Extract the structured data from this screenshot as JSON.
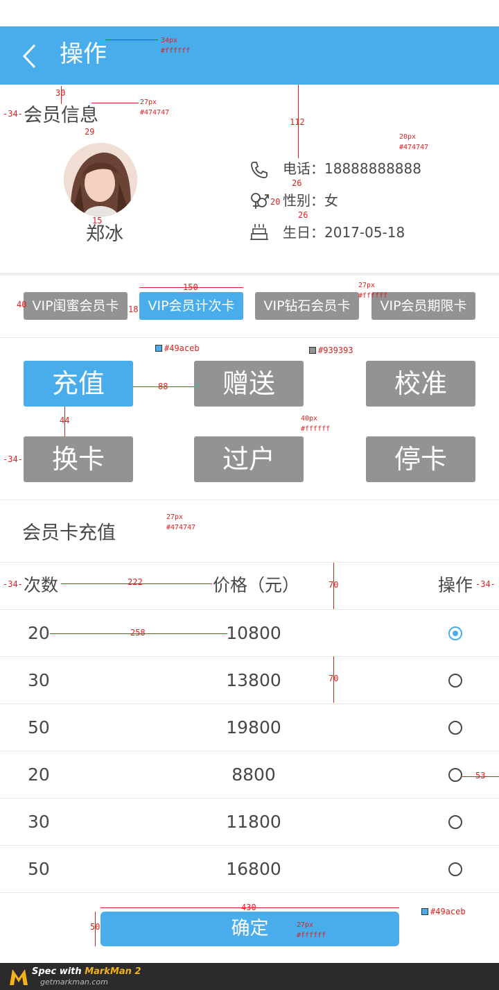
{
  "header": {
    "title": "操作",
    "bg_color": "#49aceb"
  },
  "member_info": {
    "section_title": "会员信息",
    "name": "郑冰",
    "phone": "电话：18888888888",
    "gender": "性别：女",
    "birthday": "生日：2017-05-18"
  },
  "card_tabs": [
    {
      "label": "VIP闺蜜会员卡",
      "active": false
    },
    {
      "label": "VIP会员计次卡",
      "active": true
    },
    {
      "label": "VIP钻石会员卡",
      "active": false
    },
    {
      "label": "VIP会员期限卡",
      "active": false
    }
  ],
  "operations": [
    {
      "label": "充值",
      "active": true
    },
    {
      "label": "赠送",
      "active": false
    },
    {
      "label": "校准",
      "active": false
    },
    {
      "label": "换卡",
      "active": false
    },
    {
      "label": "过户",
      "active": false
    },
    {
      "label": "停卡",
      "active": false
    }
  ],
  "recharge": {
    "section_title": "会员卡充值",
    "columns": [
      "次数",
      "价格（元）",
      "操作"
    ],
    "rows": [
      {
        "count": "20",
        "price": "10800",
        "selected": true
      },
      {
        "count": "30",
        "price": "13800",
        "selected": false
      },
      {
        "count": "50",
        "price": "19800",
        "selected": false
      },
      {
        "count": "20",
        "price": "8800",
        "selected": false
      },
      {
        "count": "30",
        "price": "11800",
        "selected": false
      },
      {
        "count": "50",
        "price": "16800",
        "selected": false
      }
    ],
    "confirm_label": "确定"
  },
  "colors": {
    "primary": "#49aceb",
    "gray_button": "#939393",
    "text": "#474747",
    "white": "#ffffff"
  },
  "spec": {
    "a_title_size": "34px",
    "a_title_color": "#ffffff",
    "a_30": "30",
    "a_34": "-34-",
    "a_27px": "27px",
    "a_474747": "#474747",
    "a_29": "29",
    "a_112": "112",
    "a_20px": "20px",
    "a_474747_b": "#474747",
    "a_26a": "26",
    "a_20": "20",
    "a_26b": "26",
    "a_15": "15",
    "a_150": "150",
    "a_40": "40",
    "a_18": "18",
    "a_27px_b": "27px",
    "a_ffffff": "#ffffff",
    "a_49aceb": "#49aceb",
    "a_939393": "#939393",
    "a_88": "88",
    "a_44": "44",
    "a_40px": "40px",
    "a_ffffff_b": "#ffffff",
    "a_34b": "-34-",
    "a_27px_c": "27px",
    "a_474747_c": "#474747",
    "a_34c": "-34-",
    "a_222": "222",
    "a_70": "70",
    "a_34d": "-34-",
    "a_258": "258",
    "a_70b": "70",
    "a_53": "53",
    "a_430": "430",
    "a_50": "50",
    "a_27px_d": "27px",
    "a_ffffff_c": "#ffffff",
    "a_49aceb_b": "#49aceb"
  },
  "footer": {
    "line1_prefix": "Spec with ",
    "line1_brand": "MarkMan 2",
    "line2": "getmarkman.com"
  }
}
